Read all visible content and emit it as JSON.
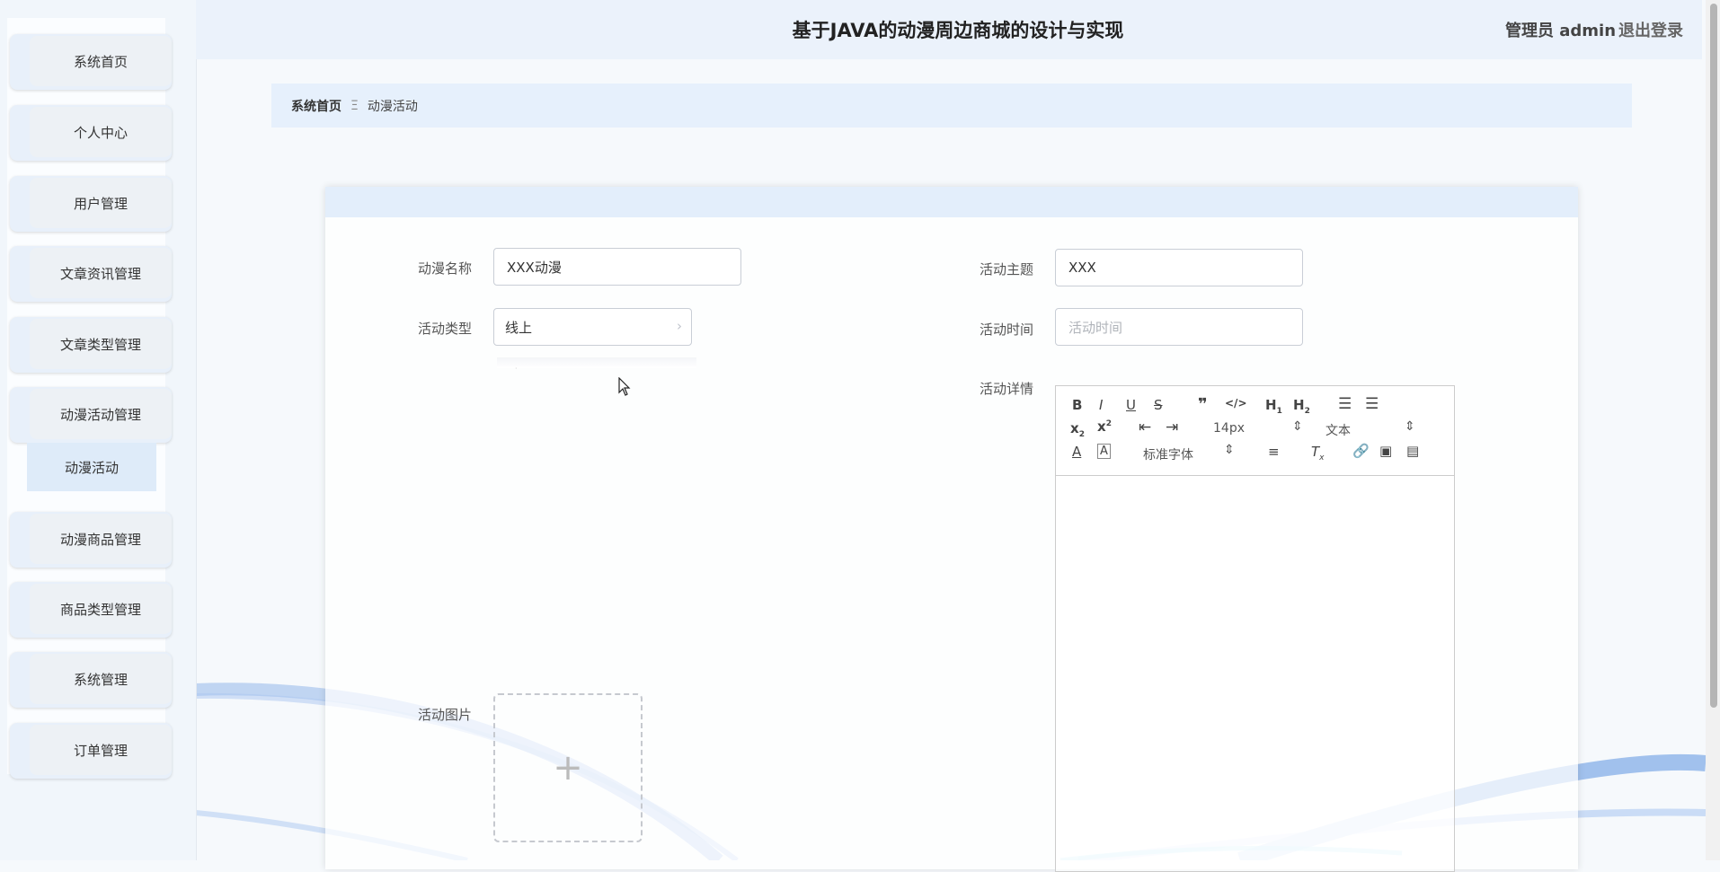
{
  "app_title": "基于JAVA的动漫周边商城的设计与实现",
  "header": {
    "user": "管理员 admin",
    "logout": "退出登录"
  },
  "sidebar": {
    "items": [
      {
        "label": "系统首页"
      },
      {
        "label": "个人中心"
      },
      {
        "label": "用户管理"
      },
      {
        "label": "文章资讯管理"
      },
      {
        "label": "文章类型管理"
      },
      {
        "label": "动漫活动管理"
      },
      {
        "label": "动漫商品管理"
      },
      {
        "label": "商品类型管理"
      },
      {
        "label": "系统管理"
      },
      {
        "label": "订单管理"
      }
    ],
    "submenu": {
      "label": "动漫活动"
    }
  },
  "breadcrumb": {
    "home": "系统首页",
    "separator": "Ξ",
    "current": "动漫活动"
  },
  "form": {
    "anime_name": {
      "label": "动漫名称",
      "value": "XXX动漫"
    },
    "activity_theme": {
      "label": "活动主题",
      "value": "XXX"
    },
    "activity_type": {
      "label": "活动类型",
      "value": "线上"
    },
    "activity_time": {
      "label": "活动时间",
      "placeholder": "活动时间"
    },
    "activity_details": {
      "label": "活动详情"
    },
    "activity_image": {
      "label": "活动图片",
      "upload_icon": "+"
    }
  },
  "editor_toolbar": {
    "font_size": "14px",
    "block_format": "文本",
    "font_family": "标准字体"
  },
  "colors": {
    "accent": "#e6f0fc",
    "sidebar_bg": "#f1f6fb",
    "header_bg": "#ebf2fb"
  }
}
